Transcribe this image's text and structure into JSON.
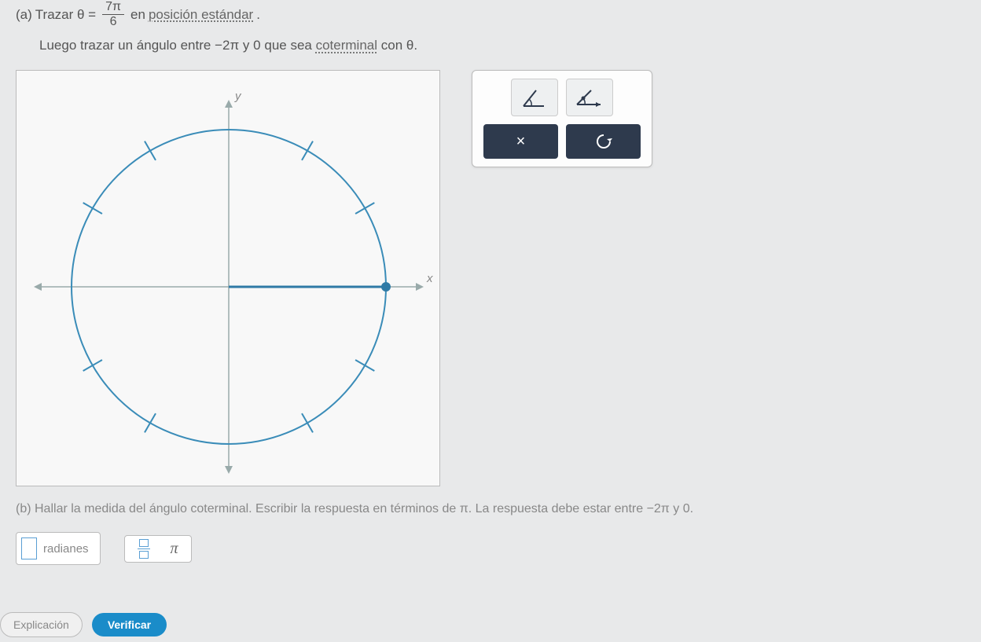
{
  "problem": {
    "part_a": {
      "label": "(a)",
      "prefix": "Trazar θ =",
      "fraction_num": "7π",
      "fraction_den": "6",
      "mid": "en",
      "term1": "posición estándar",
      "suffix1": ".",
      "line2_prefix": "Luego trazar un ángulo entre",
      "neg2pi": "−2π",
      "and_word": "y",
      "zero": "0",
      "mid2": "que sea",
      "term2": "coterminal",
      "line2_suffix": "con θ."
    },
    "part_b": {
      "text": "(b) Hallar la medida del ángulo coterminal. Escribir la respuesta en términos de π. La respuesta debe estar entre −2π y 0."
    }
  },
  "chart_data": {
    "type": "unit-circle",
    "axes": {
      "x_label": "x",
      "y_label": "y"
    },
    "radius": 1,
    "tick_interval_degrees": 30,
    "initial_ray_angle_degrees": 0,
    "point_on_circle": {
      "angle_degrees": 0
    }
  },
  "tools": {
    "angle_tool": "angle-icon",
    "ray_tool": "ray-angle-icon",
    "clear": "×",
    "reset": "↺"
  },
  "answer": {
    "unit": "radianes",
    "pi_symbol": "π"
  },
  "buttons": {
    "explain": "Explicación",
    "verify": "Verificar"
  }
}
